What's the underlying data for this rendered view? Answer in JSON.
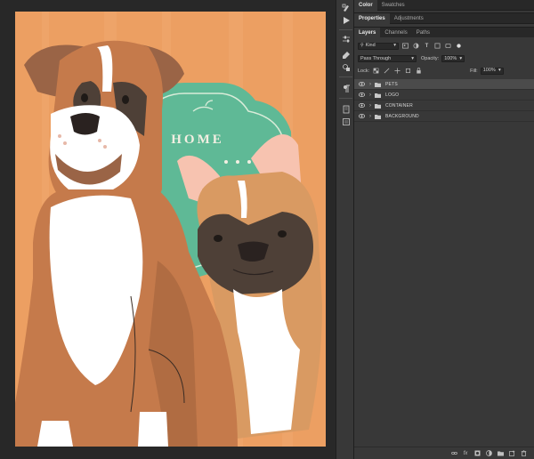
{
  "artwork": {
    "sign_text": "HOME"
  },
  "panels": {
    "top_tabs": [
      "Color",
      "Swatches"
    ],
    "mid_tabs": [
      "Properties",
      "Adjustments"
    ],
    "layer_tabs": [
      "Layers",
      "Channels",
      "Paths"
    ]
  },
  "layers_panel": {
    "filter_value": "Kind",
    "blend_mode": "Pass Through",
    "opacity_label": "Opacity:",
    "opacity_value": "100%",
    "lock_label": "Lock:",
    "fill_label": "Fill:",
    "fill_value": "100%",
    "layers": [
      {
        "name": "PETS",
        "selected": true
      },
      {
        "name": "LOGO",
        "selected": false
      },
      {
        "name": "CONTAINER",
        "selected": false
      },
      {
        "name": "BACKGROUND",
        "selected": false
      }
    ],
    "bottom_fx_label": "fx"
  },
  "colors": {
    "background_orange": "#ec9f62",
    "teal": "#5fb996",
    "boxer_fawn": "#c57a4b",
    "frenchie_fawn": "#d99a62",
    "mask": "#4e4037",
    "white": "#ffffff"
  }
}
